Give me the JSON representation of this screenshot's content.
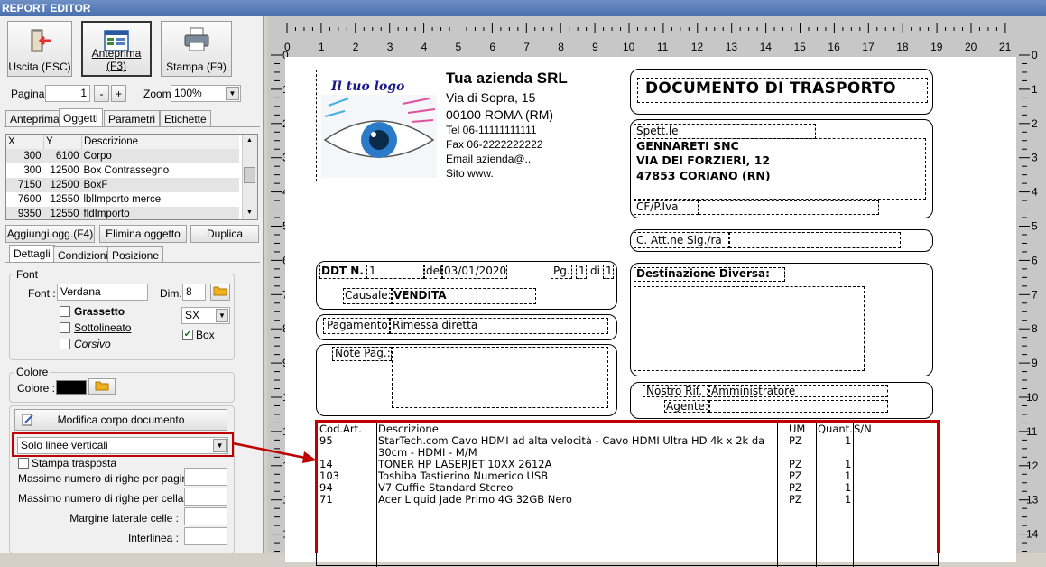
{
  "window": {
    "title": "REPORT EDITOR"
  },
  "toolbar": {
    "exit_label": "Uscita (ESC)",
    "preview_label": "Anteprima (F3)",
    "print_label": "Stampa (F9)"
  },
  "nav": {
    "page_label": "Pagina",
    "page_value": "1",
    "minus": "-",
    "plus": "+",
    "zoom_label": "Zoom",
    "zoom_value": "100%"
  },
  "tabs_top": [
    "Anteprima",
    "Oggetti",
    "Parametri",
    "Etichette"
  ],
  "objects_table": {
    "headers": [
      "X",
      "Y",
      "Descrizione"
    ],
    "rows": [
      [
        "300",
        "6100",
        "Corpo"
      ],
      [
        "300",
        "12500",
        "Box Contrassegno"
      ],
      [
        "7150",
        "12500",
        "BoxF"
      ],
      [
        "7600",
        "12550",
        "lblImporto merce"
      ],
      [
        "9350",
        "12550",
        "fldImporto"
      ]
    ]
  },
  "object_buttons": {
    "add": "Aggiungi ogg.(F4)",
    "delete": "Elimina oggetto",
    "duplicate": "Duplica"
  },
  "tabs_detail": [
    "Dettagli",
    "Condizioni",
    "Posizione"
  ],
  "font": {
    "group_title": "Font",
    "font_label": "Font :",
    "font_value": "Verdana",
    "dim_label": "Dim.",
    "dim_value": "8",
    "bold": "Grassetto",
    "underline": "Sottolineato",
    "italic": "Corsivo",
    "align_value": "SX",
    "box_label": "Box",
    "box_checked": true
  },
  "color": {
    "group_title": "Colore",
    "label": "Colore :",
    "value": "#000000"
  },
  "body": {
    "edit_button": "Modifica corpo documento",
    "lines_value": "Solo linee verticali",
    "transposed_label": "Stampa trasposta",
    "max_rows_page": "Massimo numero di righe per pagina :",
    "max_rows_cell": "Massimo numero di righe per cella :",
    "cell_margin": "Margine laterale celle :",
    "line_spacing": "Interlinea :"
  },
  "ruler": {
    "h": [
      "0",
      "1",
      "2",
      "3",
      "4",
      "5",
      "6",
      "7",
      "8",
      "9",
      "10",
      "11",
      "12",
      "13",
      "14",
      "15",
      "16",
      "17",
      "18",
      "19",
      "20",
      "21"
    ],
    "v": [
      "0",
      "1",
      "2",
      "3",
      "4",
      "5",
      "6",
      "7",
      "8",
      "9",
      "10",
      "11",
      "12",
      "13",
      "14"
    ]
  },
  "document": {
    "logo_text": "Il tuo logo",
    "company_name": "Tua azienda SRL",
    "company_lines": [
      "Via di Sopra, 15",
      "00100 ROMA (RM)",
      "Tel 06-11111111111",
      "Fax 06-2222222222",
      "Email azienda@..",
      "Sito www."
    ],
    "doc_title": "DOCUMENTO DI TRASPORTO",
    "spett_label": "Spett.le",
    "customer_lines": [
      "GENNARETI SNC",
      "VIA DEI FORZIERI, 12",
      "47853 CORIANO (RN)"
    ],
    "vat_label": "CF/P.Iva",
    "attn_label": "C. Att.ne Sig./ra",
    "ddt_label": "DDT N.",
    "ddt_number": "1",
    "date_label": "del",
    "date_value": "03/01/2020",
    "pg_label": "Pg.",
    "pg_value": "1",
    "pg_of": "di",
    "pg_total": "1",
    "causale_label": "Causale:",
    "causale_value": "VENDITA",
    "dest_label": "Destinazione Diversa:",
    "payment_label": "Pagamento",
    "payment_value": "Rimessa diretta",
    "note_label": "Note Pag.:",
    "ref_label": "Nostro Rif. :",
    "ref_value": "Amministratore",
    "agent_label": "Agente:",
    "lines_headers": {
      "code": "Cod.Art.",
      "desc": "Descrizione",
      "um": "UM",
      "qty": "Quant.",
      "sn": "S/N"
    },
    "lines": [
      {
        "code": "95",
        "desc": "StarTech.com Cavo HDMI ad alta velocità - Cavo HDMI Ultra HD 4k x 2k da",
        "um": "PZ",
        "qty": "1"
      },
      {
        "code": "",
        "desc": "30cm - HDMI - M/M",
        "um": "",
        "qty": ""
      },
      {
        "code": "14",
        "desc": "TONER HP LASERJET 10XX 2612A",
        "um": "PZ",
        "qty": "1"
      },
      {
        "code": "103",
        "desc": "Toshiba Tastierino Numerico USB",
        "um": "PZ",
        "qty": "1"
      },
      {
        "code": "94",
        "desc": "V7 Cuffie Standard Stereo",
        "um": "PZ",
        "qty": "1"
      },
      {
        "code": "71",
        "desc": "Acer Liquid Jade Primo 4G 32GB Nero",
        "um": "PZ",
        "qty": "1"
      }
    ]
  },
  "colors": {
    "highlight": "#c00000",
    "titlebar": "#4a6fae"
  }
}
